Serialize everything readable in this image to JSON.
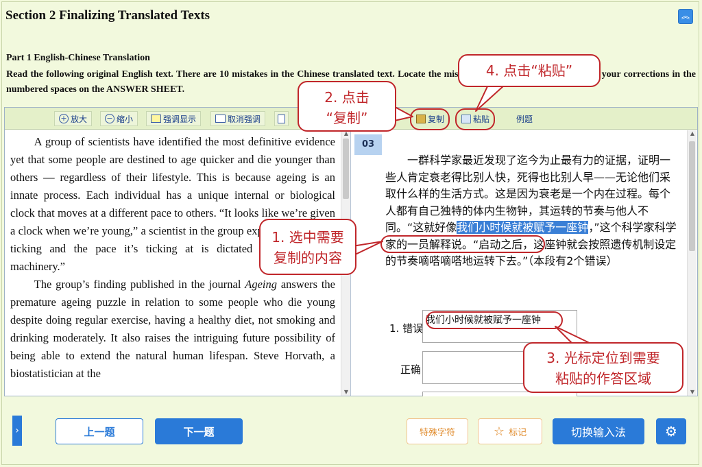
{
  "section_title": "Section 2 Finalizing Translated Texts",
  "part_title": "Part 1 English-Chinese Translation",
  "instructions": "Read the following original English text. There are 10 mistakes in the Chinese translated text. Locate the mistranslations or omissions and give your corrections in the numbered spaces on the ANSWER SHEET.",
  "toolbar": {
    "zoom_in": "放大",
    "zoom_out": "缩小",
    "highlight": "强调显示",
    "unhighlight": "取消强调",
    "copy": "复制",
    "paste": "粘贴",
    "example": "例题"
  },
  "source": {
    "p1": "A group of scientists have identified the most definitive evidence yet that some people are destined to age quicker and die younger than others — regardless of their lifestyle. This is because ageing is an innate process. Each individual has a unique internal or biological clock that moves at a different pace to others. “It looks like we’re given a clock when we’re young,” a scientist in the group explained. “It starts ticking and the pace it’s ticking at is dictated by our genetic machinery.”",
    "p2_start": "The group’s finding published in the journal ",
    "p2_journal": "Ageing",
    "p2_end": " answers the premature ageing puzzle in relation to some people who die young despite doing regular exercise, having a healthy diet, not smoking and drinking moderately. It also raises the intriguing future possibility of being able to extend the natural human lifespan. Steve Horvath, a biostatistician at the"
  },
  "question": {
    "number": "03",
    "cn_before": "一群科学家最近发现了迄今为止最有力的证据，证明一些人肯定衰老得比别人快，死得也比别人早——无论他们采取什么样的生活方式。这是因为衰老是一个内在过程。每个人都有自己独特的体内生物钟，其运转的节奏与他人不同。“这就好像",
    "cn_selected": "我们小时候就被赋予一座钟",
    "cn_after": "，”这个科学家科学家的一员解释说。“启动之后，这座钟就会按照遗传机制设定的节奏嘀嗒嘀嗒地运转下去。”（本段有2个错误）",
    "error_label": "1. 错误",
    "correct_label": "正确",
    "error_value": "我们小时候就被赋予一座钟",
    "correct_value": ""
  },
  "bottom": {
    "prev": "上一题",
    "next": "下一题",
    "special_chars": "特殊字符",
    "mark": "标记",
    "switch_input": "切换输入法"
  },
  "annotations": {
    "step1": "1. 选中需要\n复制的内容",
    "step2": "2. 点击\n“复制”",
    "step3": "3. 光标定位到需要\n粘贴的作答区域",
    "step4": "4. 点击“粘贴”"
  },
  "colors": {
    "accent": "#2a7ad8",
    "annotation": "#c0262a",
    "selection": "#3a7fd6",
    "background": "#f3f9dc"
  }
}
